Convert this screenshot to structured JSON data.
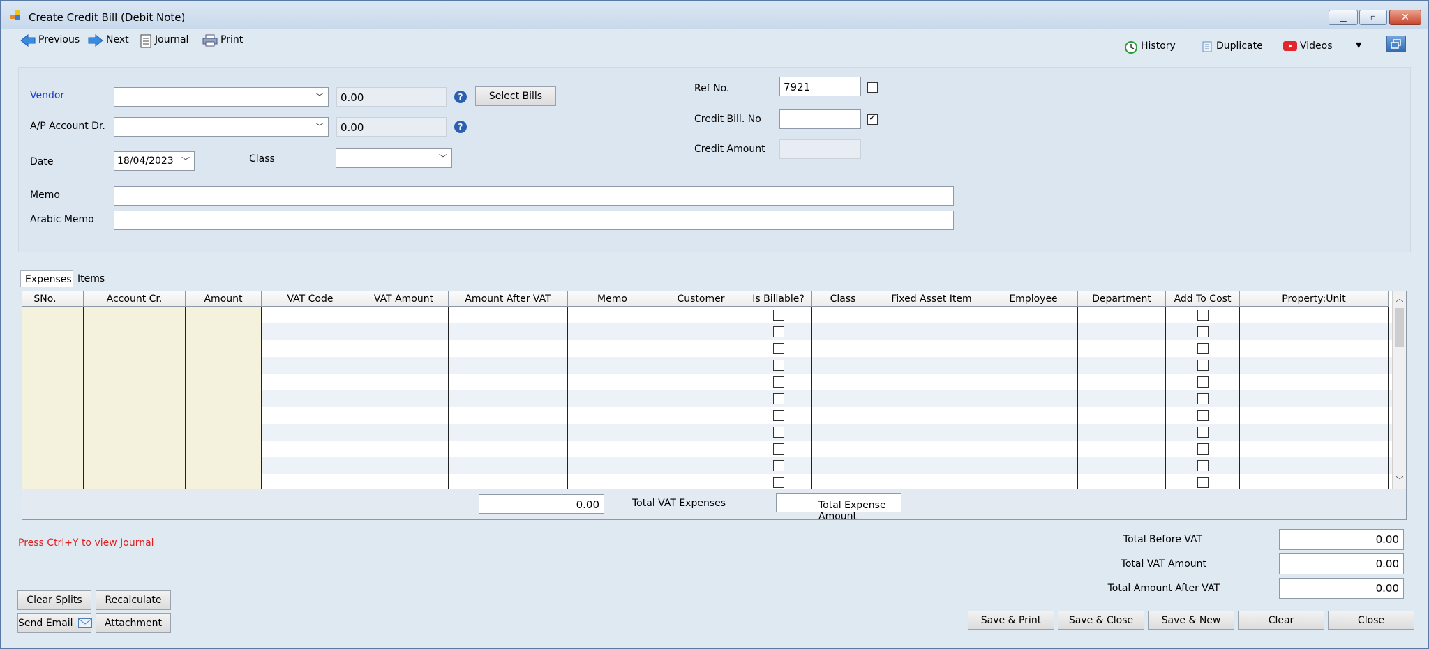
{
  "window": {
    "title": "Create Credit Bill (Debit Note)"
  },
  "toolbar": {
    "previous": "Previous",
    "next": "Next",
    "journal": "Journal",
    "print": "Print",
    "history": "History",
    "duplicate": "Duplicate",
    "videos": "Videos"
  },
  "form": {
    "vendor_label": "Vendor",
    "vendor_balance": "0.00",
    "ap_label": "A/P Account Dr.",
    "ap_balance": "0.00",
    "select_bills": "Select Bills",
    "date_label": "Date",
    "date_value": "18/04/2023",
    "class_label": "Class",
    "memo_label": "Memo",
    "arabic_memo_label": "Arabic Memo",
    "ref_label": "Ref No.",
    "ref_value": "7921",
    "credit_bill_no_label": "Credit Bill. No",
    "credit_amount_label": "Credit Amount"
  },
  "tabs": {
    "expenses": "Expenses",
    "items": "Items"
  },
  "grid": {
    "columns": [
      "SNo.",
      "",
      "Account Cr.",
      "Amount",
      "VAT Code",
      "VAT Amount",
      "Amount After VAT",
      "Memo",
      "Customer",
      "Is Billable?",
      "Class",
      "Fixed Asset Item",
      "Employee",
      "Department",
      "Add To Cost",
      "Property:Unit"
    ],
    "total_vat_value": "0.00",
    "total_vat_label": "Total VAT Expenses",
    "total_expense_label": "Total Expense Amount"
  },
  "hint": "Press Ctrl+Y to view Journal",
  "totals": {
    "before_vat_label": "Total Before VAT",
    "before_vat_value": "0.00",
    "vat_label": "Total VAT Amount",
    "vat_value": "0.00",
    "after_vat_label": "Total Amount After VAT",
    "after_vat_value": "0.00"
  },
  "buttons": {
    "clear_splits": "Clear Splits",
    "recalculate": "Recalculate",
    "send_email": "Send Email",
    "attachment": "Attachment",
    "save_print": "Save & Print",
    "save_close": "Save & Close",
    "save_new": "Save & New",
    "clear": "Clear",
    "close": "Close"
  },
  "colors": {
    "required_label": "#1a3fcf",
    "hint": "#e02020",
    "grid_fixed_cols": "#f4f2dc",
    "grid_stripe": "#edf2f9"
  }
}
